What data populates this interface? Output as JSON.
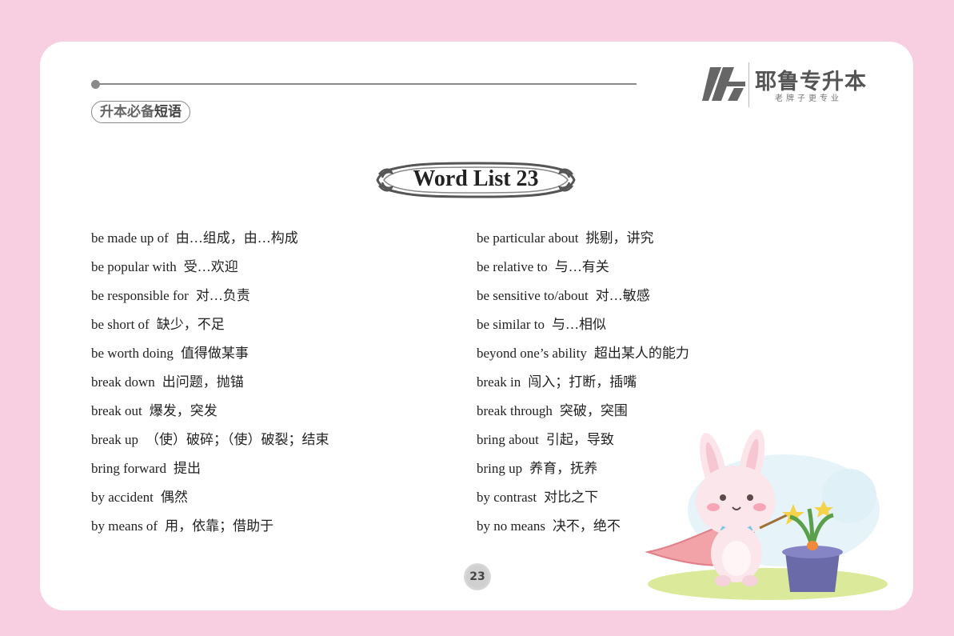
{
  "header": {
    "section_tag_prefix": "升本必备",
    "section_tag_strong": "短语",
    "brand_name": "耶鲁专升本",
    "brand_slogan": "老牌子更专业"
  },
  "title": "Word List 23",
  "left_column": [
    {
      "term": "be made up of",
      "meaning": "由…组成，由…构成"
    },
    {
      "term": "be popular with",
      "meaning": "受…欢迎"
    },
    {
      "term": "be responsible for",
      "meaning": "对…负责"
    },
    {
      "term": "be short of",
      "meaning": "缺少，不足"
    },
    {
      "term": "be worth doing",
      "meaning": "值得做某事"
    },
    {
      "term": "break down",
      "meaning": "出问题，抛锚"
    },
    {
      "term": "break out",
      "meaning": "爆发，突发"
    },
    {
      "term": "break up",
      "meaning": "（使）破碎；（使）破裂；结束"
    },
    {
      "term": "bring forward",
      "meaning": "提出"
    },
    {
      "term": "by accident",
      "meaning": "偶然"
    },
    {
      "term": "by means of",
      "meaning": "用，依靠；借助于"
    }
  ],
  "right_column": [
    {
      "term": "be particular about",
      "meaning": "挑剔，讲究"
    },
    {
      "term": "be relative to",
      "meaning": "与…有关"
    },
    {
      "term": "be sensitive to/about",
      "meaning": "对…敏感"
    },
    {
      "term": "be similar to",
      "meaning": "与…相似"
    },
    {
      "term": "beyond one’s ability",
      "meaning": "超出某人的能力"
    },
    {
      "term": "break in",
      "meaning": "闯入；打断，插嘴"
    },
    {
      "term": "break through",
      "meaning": "突破，突围"
    },
    {
      "term": "bring about",
      "meaning": "引起，导致"
    },
    {
      "term": "bring up",
      "meaning": "养育，抚养"
    },
    {
      "term": "by contrast",
      "meaning": "对比之下"
    },
    {
      "term": "by no means",
      "meaning": "决不，绝不"
    }
  ],
  "page_number": "23",
  "colors": {
    "page_background": "#f7cfe0",
    "card": "#ffffff",
    "accent_gray": "#8a8a8a"
  }
}
